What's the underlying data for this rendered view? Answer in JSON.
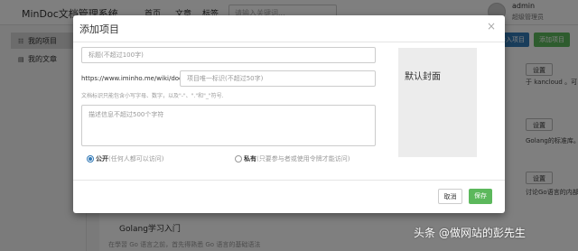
{
  "header": {
    "brand": "MinDoc文档管理系统",
    "nav": [
      "首页",
      "文章",
      "标签"
    ],
    "search_placeholder": "请输入关键词...",
    "user_name": "admin",
    "user_role": "超级管理员"
  },
  "sidebar": {
    "items": [
      {
        "icon": "sitemap-icon",
        "label": "我的项目"
      },
      {
        "icon": "document-icon",
        "label": "我的文章"
      }
    ]
  },
  "main": {
    "import_label": "导入项目",
    "add_label": "添加项目",
    "settings_label": "设置",
    "peek_texts": [
      "于 kancloud 。可以",
      "Golang的标准库。",
      "讨论Go语言的内部实现"
    ],
    "course_title": "Golang学习入门",
    "course_desc": "在學習 Go 语言之前，首先得熟悉 Go 语言的基础语法"
  },
  "modal": {
    "title": "添加项目",
    "close": "×",
    "title_placeholder": "标题(不超过100字)",
    "url_prefix": "https://www.iminho.me/wiki/docs/",
    "identifier_placeholder": "项目唯一标识(不超过50字)",
    "identifier_help": "文档标识只能包含小写字母、数字，以及\"-\"、\".\"和\"_\"符号.",
    "description_placeholder": "描述信息不超过500个字符",
    "cover_label": "默认封面",
    "public_label": "公开",
    "public_hint": "(任何人都可以访问)",
    "private_label": "私有",
    "private_hint": "(只要参与者或使用令牌才能访问)",
    "cancel_label": "取消",
    "save_label": "保存",
    "visibility": "public"
  },
  "watermark": "头条 @做网站的彭先生",
  "colors": {
    "primary": "#337ab7",
    "success": "#5cb85c",
    "overlay": "rgba(0,0,0,0.5)"
  }
}
